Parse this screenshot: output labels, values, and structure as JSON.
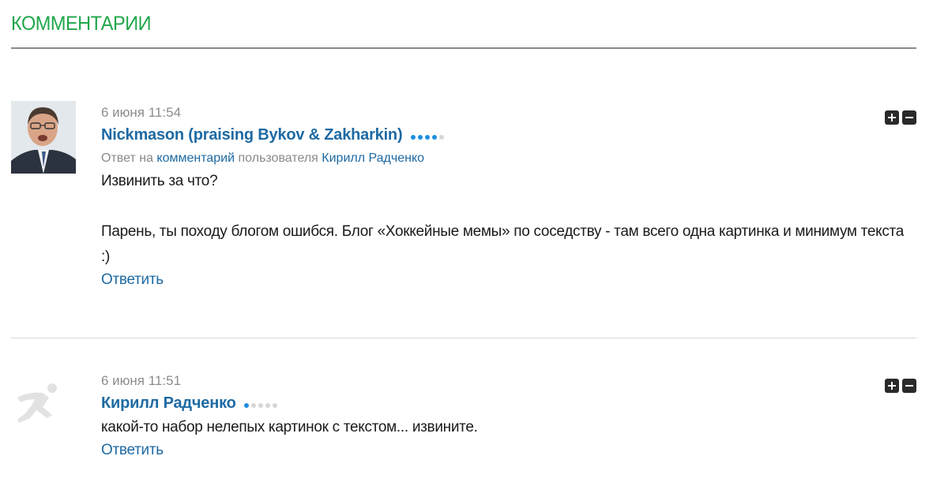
{
  "section": {
    "title": "КОММЕНТАРИИ"
  },
  "comments": [
    {
      "date": "6 июня 11:54",
      "author": "Nickmason (praising Bykov & Zakharkin)",
      "rating": {
        "filled": 4,
        "total": 5
      },
      "reply_to": {
        "prefix": "Ответ на",
        "link": "комментарий",
        "middle": "пользователя",
        "user": "Кирилл Радченко"
      },
      "paragraphs": [
        "Извинить за что?",
        "Парень, ты походу блогом ошибся. Блог «Хоккейные мемы» по соседству - там всего одна картинка и минимум текста :)"
      ],
      "reply_label": "Ответить",
      "avatar": "user-photo"
    },
    {
      "date": "6 июня 11:51",
      "author": "Кирилл Радченко",
      "rating": {
        "filled": 1,
        "total": 5
      },
      "paragraphs": [
        "какой-то набор нелепых картинок с текстом... извините."
      ],
      "reply_label": "Ответить",
      "avatar": "runner-placeholder-icon"
    }
  ],
  "controls": {
    "expand_icon": "plus-icon",
    "collapse_icon": "minus-icon"
  },
  "colors": {
    "section_title": "#1fa64a",
    "link": "#1e6aa3",
    "rating_on": "#1d8fe0",
    "rating_off": "#d6d6d6"
  }
}
